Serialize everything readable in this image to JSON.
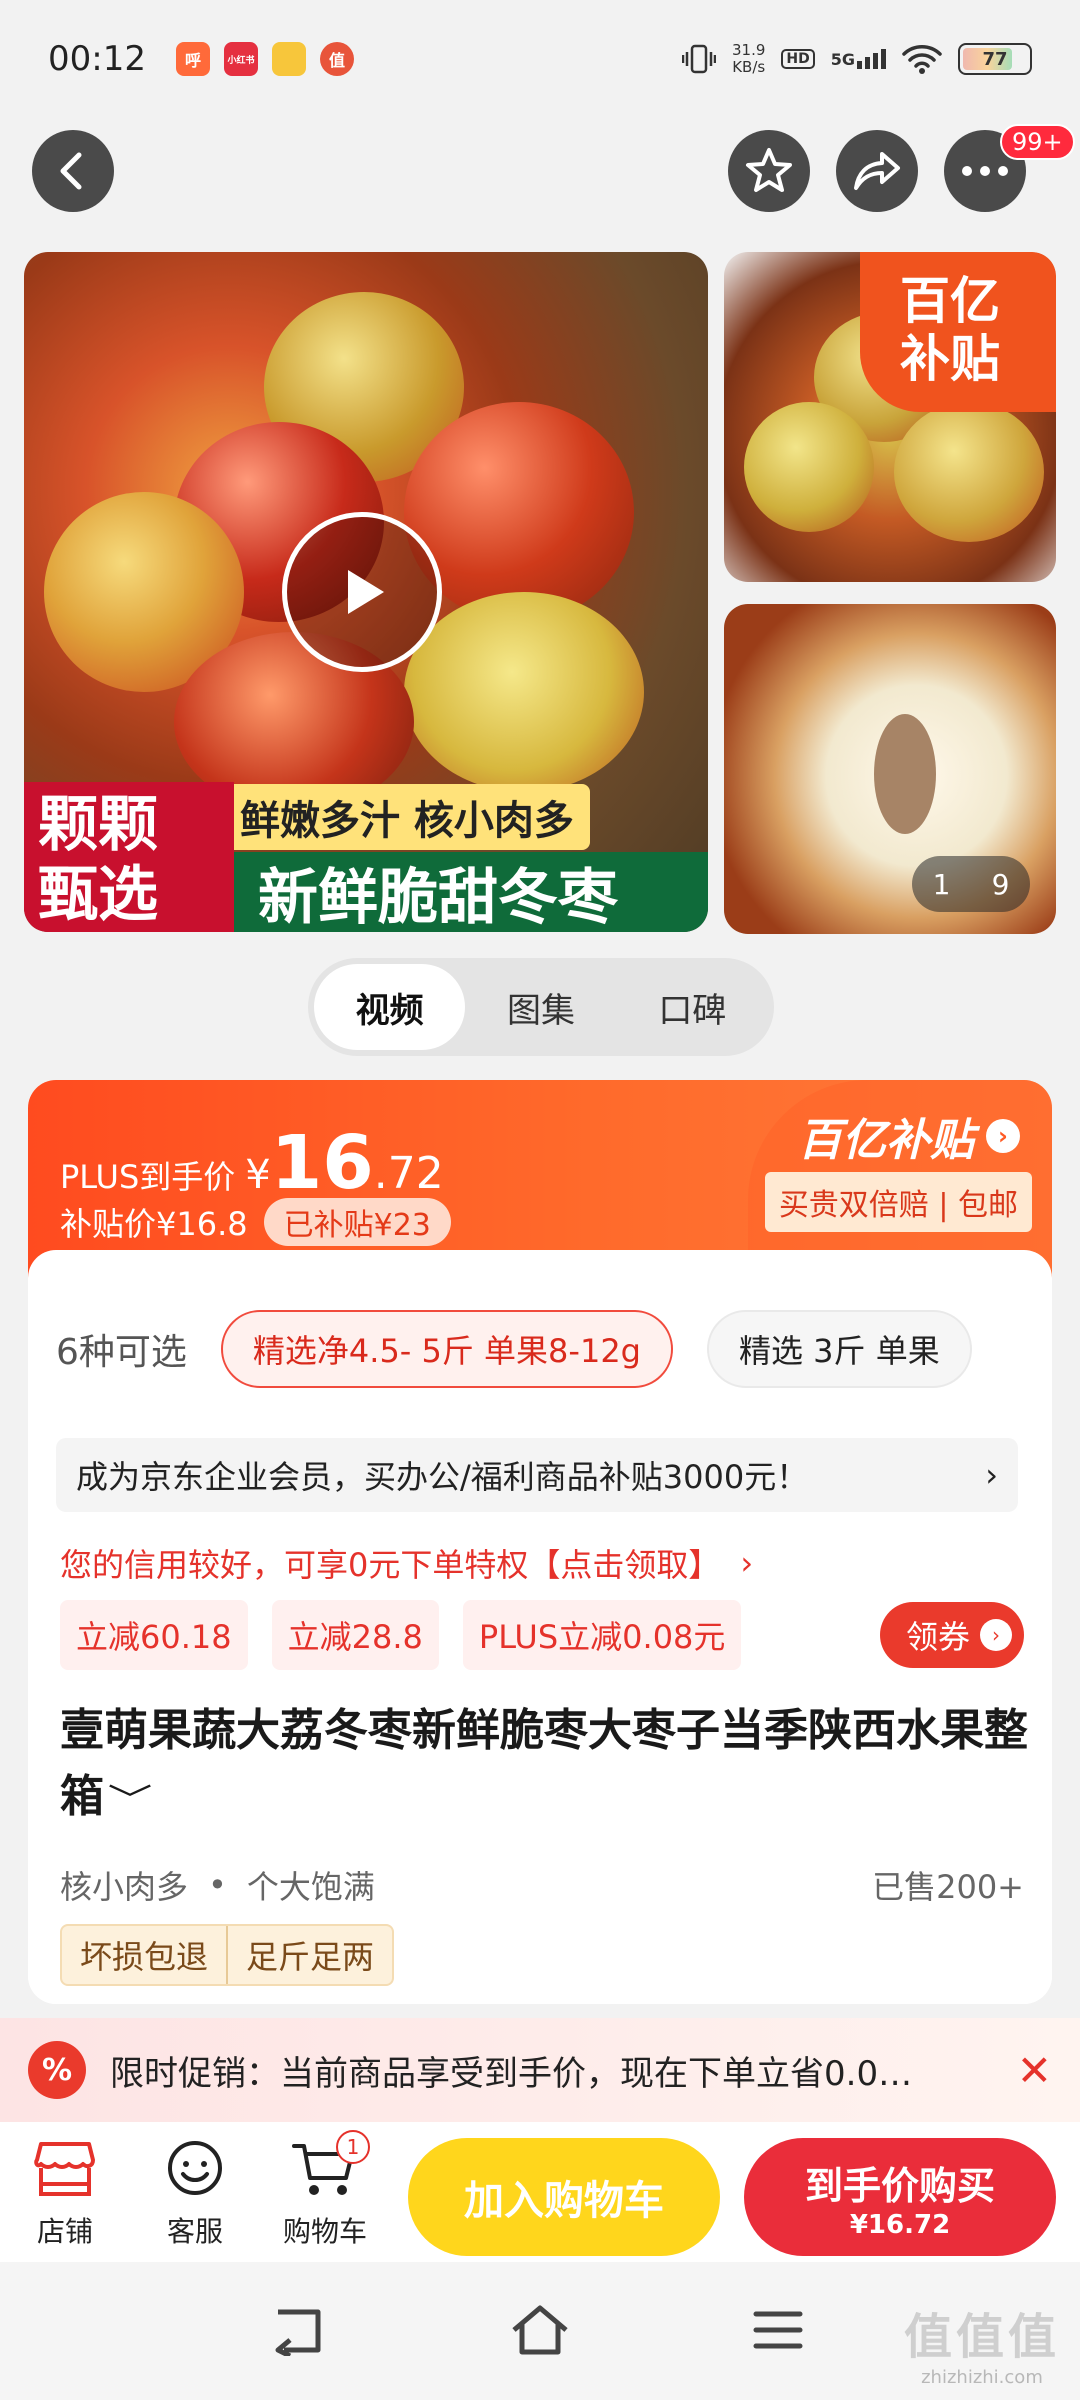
{
  "status_bar": {
    "time": "00:12",
    "net_speed_value": "31.9",
    "net_speed_unit": "KB/s",
    "hd": "HD",
    "network": "5G",
    "battery": "77",
    "app_icons": [
      {
        "name": "app-icon-1",
        "color": "#ff6a3a",
        "label": "呼"
      },
      {
        "name": "app-icon-2",
        "color": "#e53040",
        "label": "小红书"
      },
      {
        "name": "app-icon-3",
        "color": "#f7c63b",
        "label": ""
      },
      {
        "name": "app-icon-4",
        "color": "#e8543a",
        "label": "值"
      }
    ]
  },
  "top_nav": {
    "badge": "99+"
  },
  "gallery": {
    "hero_tag": "鲜嫩多汁 核小肉多",
    "hero_red_line1": "颗颗",
    "hero_red_line2": "甄选",
    "hero_green": "新鲜脆甜冬枣",
    "corner_badge_line1": "百亿",
    "corner_badge_line2": "补贴",
    "pager_current": "1",
    "pager_total": "9"
  },
  "media_tabs": [
    {
      "label": "视频",
      "active": true
    },
    {
      "label": "图集",
      "active": false
    },
    {
      "label": "口碑",
      "active": false
    }
  ],
  "price": {
    "plus_label": "PLUS到手价",
    "currency": "¥",
    "integer": "16",
    "decimal": ".72",
    "subsidy_price": "补贴价¥16.8",
    "subsidy_pill": "已补贴¥23",
    "brand": "百亿补贴",
    "guarantee": "买贵双倍赔 | 包邮"
  },
  "specs": {
    "count": "6种可选",
    "options": [
      {
        "label": "精选净4.5- 5斤 单果8-12g",
        "selected": true
      },
      {
        "label": "精选 3斤 单果",
        "selected": false
      }
    ]
  },
  "member_banner": {
    "text": "成为京东企业会员，买办公/福利商品补贴3000元！",
    "arrow": "›"
  },
  "credit": {
    "text": "您的信用较好，可享0元下单特权【点击领取】",
    "arrow": "›"
  },
  "coupons": [
    "立减60.18",
    "立减28.8",
    "PLUS立减0.08元"
  ],
  "coupon_button": "领券",
  "product": {
    "title": "壹萌果蔬大荔冬枣新鲜脆枣大枣子当季陕西水果整箱",
    "features": [
      "核小肉多",
      "个大饱满"
    ],
    "separator": "•",
    "sold": "已售200+",
    "service_tags": [
      "坏损包退",
      "足斤足两"
    ]
  },
  "promo_bar": {
    "icon": "%",
    "text": "限时促销：当前商品享受到手价，现在下单立省0.0…",
    "close": "✕"
  },
  "action_bar": {
    "store": "店铺",
    "service": "客服",
    "cart": "购物车",
    "cart_count": "1",
    "add_to_cart": "加入购物车",
    "buy_label": "到手价购买",
    "buy_price": "¥16.72"
  },
  "watermark": {
    "big": "值值值",
    "small": "zhizhizhi.com"
  },
  "colors": {
    "accent": "#ea2d3a",
    "orange": "#ff5a24",
    "yellow": "#ffd61c"
  }
}
